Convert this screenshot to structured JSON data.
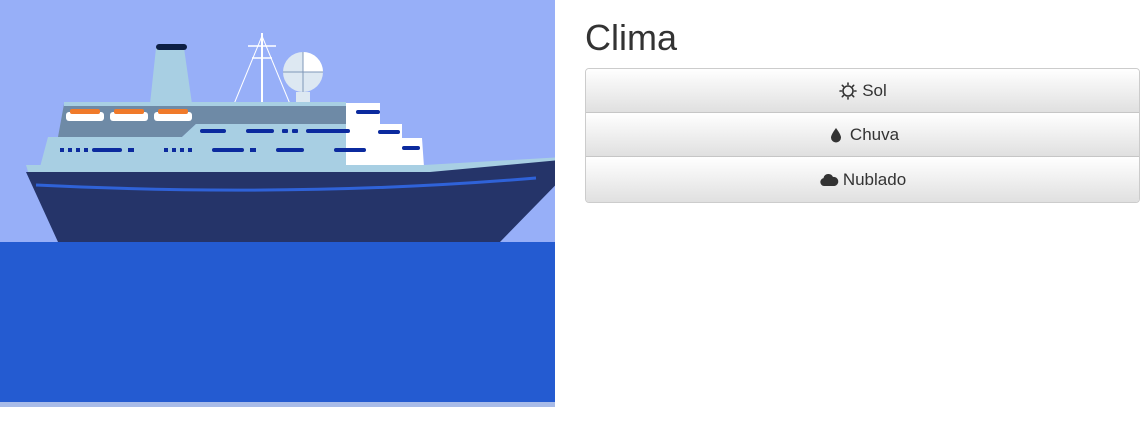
{
  "scene": {
    "image_name": "cruise-ship-illustration",
    "colors": {
      "sky": "#97aff8",
      "sea": "#245bd1",
      "sea_edge": "#a8bbe8",
      "hull": "#253469",
      "superstructure": "#a8cfe3",
      "deck_dark": "#6e8aa6",
      "lifeboat": "#f07a2a",
      "window": "#0b2a9e"
    }
  },
  "panel": {
    "title": "Clima",
    "buttons": [
      {
        "label": "Sol",
        "icon": "sun-icon"
      },
      {
        "label": "Chuva",
        "icon": "drop-icon"
      },
      {
        "label": "Nublado",
        "icon": "cloud-icon"
      }
    ]
  }
}
